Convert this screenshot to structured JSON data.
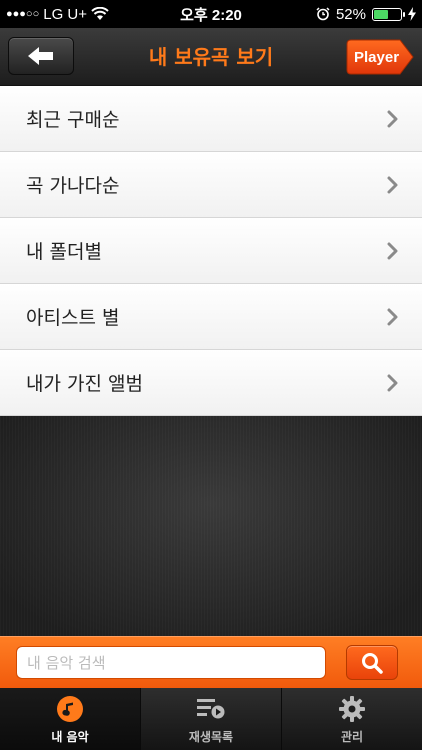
{
  "status_bar": {
    "signal": "●●●○○",
    "carrier": "LG U+",
    "time": "오후 2:20",
    "battery_percent": "52%",
    "battery_level": 0.52
  },
  "nav": {
    "title": "내 보유곡 보기",
    "player_label": "Player"
  },
  "list": {
    "items": [
      {
        "label": "최근 구매순"
      },
      {
        "label": "곡 가나다순"
      },
      {
        "label": "내 폴더별"
      },
      {
        "label": "아티스트 별"
      },
      {
        "label": "내가 가진 앨범"
      }
    ]
  },
  "search": {
    "placeholder": "내 음악 검색"
  },
  "tabs": [
    {
      "label": "내 음악",
      "icon": "music-note-icon",
      "active": true
    },
    {
      "label": "재생목록",
      "icon": "playlist-icon",
      "active": false
    },
    {
      "label": "관리",
      "icon": "gear-icon",
      "active": false
    }
  ],
  "colors": {
    "accent": "#ff7a1a",
    "battery": "#4cd964"
  }
}
